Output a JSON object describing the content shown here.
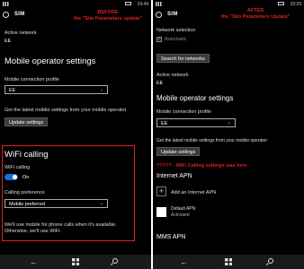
{
  "left": {
    "status_time": "19:44",
    "header_title": "SIM",
    "caption_line1": "BEFORE",
    "caption_line2": "the \"Sim Parameters update\"",
    "active_network_label": "Active network",
    "active_network_value": "EE",
    "mobile_operator_title": "Mobile operator settings",
    "mobile_profile_label": "Mobile connection profile",
    "mobile_profile_value": "EE",
    "latest_settings_text": "Get the latest mobile settings from your mobile operator",
    "update_button": "Update settings",
    "wifi_title": "WiFi calling",
    "wifi_calling_label": "WiFi calling",
    "wifi_toggle_state": "On",
    "calling_pref_label": "Calling preference",
    "calling_pref_value": "Mobile preferred",
    "wifi_note": "We'll use mobile for phone calls when it's available. Otherwise, we'll use WiFi."
  },
  "right": {
    "status_time": "10:29",
    "header_title": "SIM",
    "caption_line1": "AFTER",
    "caption_line2": "the \"Sim Parameters Update\"",
    "network_selection_label": "Network selection",
    "automatic_label": "Automatic",
    "search_networks_button": "Search for networks",
    "active_network_label": "Active network",
    "active_network_value": "EE",
    "mobile_operator_title": "Mobile operator settings",
    "mobile_profile_label": "Mobile connection profile",
    "mobile_profile_value": "EE",
    "latest_settings_text": "Get the latest mobile settings from your mobile operator",
    "update_button": "Update settings",
    "missing_note": "????? - WiFi Calling settings was here",
    "internet_apn_title": "Internet APN",
    "add_internet_apn": "Add an Internet APN",
    "default_apn_name": "Default APN",
    "default_apn_status": "Activated",
    "mms_apn_title": "MMS APN"
  },
  "icons": {
    "chevron": "⌄",
    "back": "←",
    "check": "✓",
    "plus": "+"
  },
  "colors": {
    "annotation_red": "#e02020",
    "accent_blue": "#1c6fd1"
  }
}
